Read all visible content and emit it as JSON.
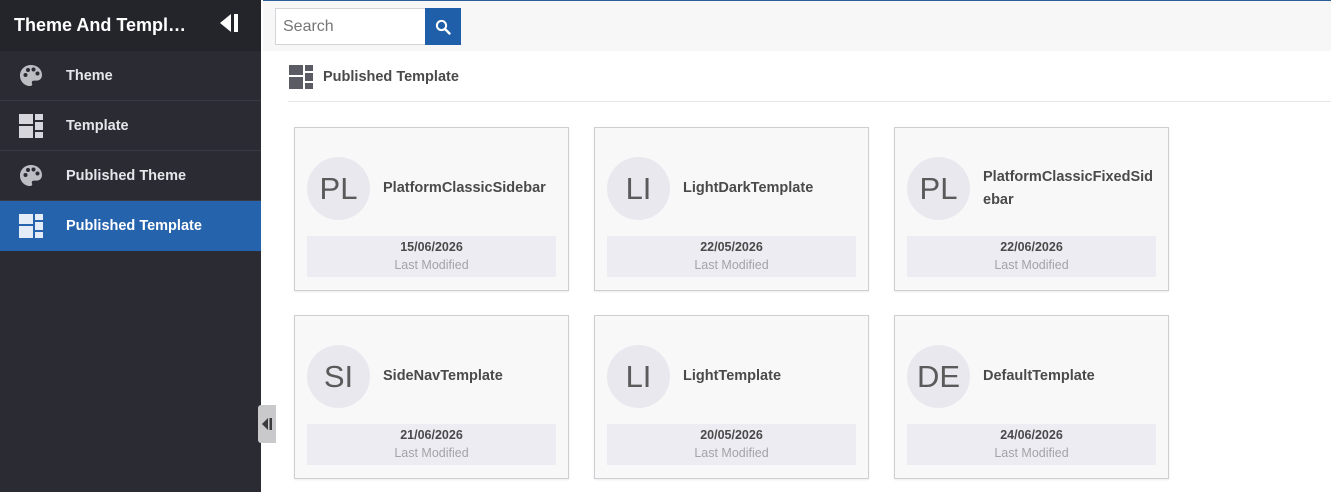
{
  "app": {
    "title": "Theme And Templ…"
  },
  "sidebar": {
    "items": [
      {
        "label": "Theme",
        "icon": "palette-icon",
        "active": false
      },
      {
        "label": "Template",
        "icon": "template-icon",
        "active": false
      },
      {
        "label": "Published Theme",
        "icon": "palette-icon",
        "active": false
      },
      {
        "label": "Published Template",
        "icon": "template-icon",
        "active": true
      }
    ]
  },
  "search": {
    "placeholder": "Search",
    "value": ""
  },
  "section": {
    "title": "Published Template"
  },
  "cards": [
    {
      "initials": "PL",
      "name": "PlatformClassicSidebar",
      "date": "15/06/2026",
      "modified_label": "Last Modified"
    },
    {
      "initials": "LI",
      "name": "LightDarkTemplate",
      "date": "22/05/2026",
      "modified_label": "Last Modified"
    },
    {
      "initials": "PL",
      "name": "PlatformClassicFixedSidebar",
      "date": "22/06/2026",
      "modified_label": "Last Modified"
    },
    {
      "initials": "SI",
      "name": "SideNavTemplate",
      "date": "21/06/2026",
      "modified_label": "Last Modified"
    },
    {
      "initials": "LI",
      "name": "LightTemplate",
      "date": "20/05/2026",
      "modified_label": "Last Modified"
    },
    {
      "initials": "DE",
      "name": "DefaultTemplate",
      "date": "24/06/2026",
      "modified_label": "Last Modified"
    }
  ],
  "colors": {
    "sidebar_bg": "#2b2b34",
    "sidebar_header_bg": "#24242b",
    "active_item": "#2563ad",
    "accent": "#1f5ea8"
  }
}
